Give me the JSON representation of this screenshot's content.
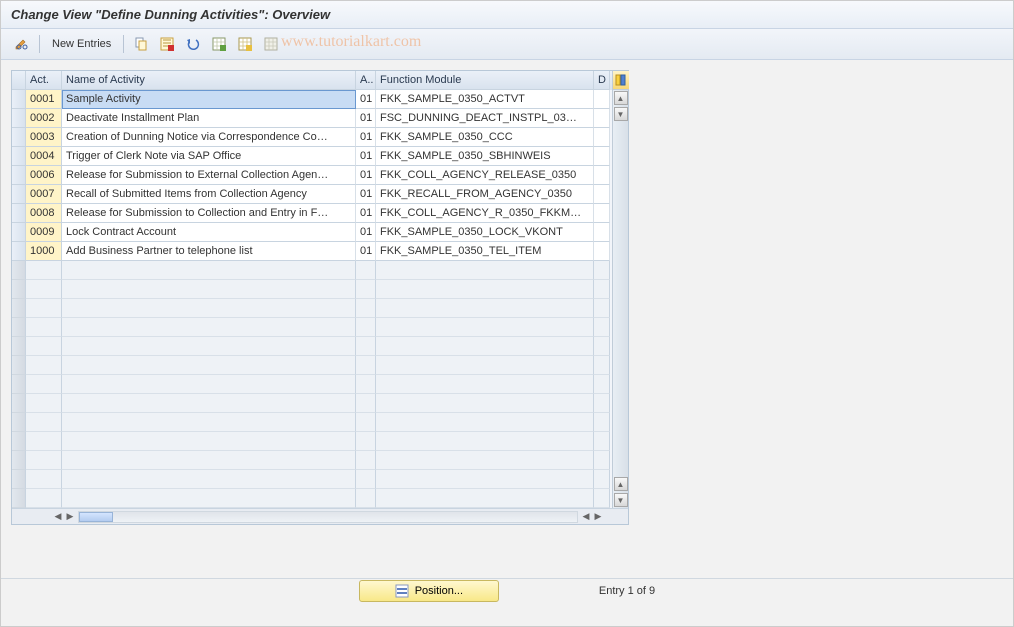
{
  "title": "Change View \"Define Dunning Activities\": Overview",
  "watermark": "www.tutorialkart.com",
  "toolbar": {
    "new_entries": "New Entries"
  },
  "table": {
    "headers": {
      "act": "Act.",
      "name": "Name of Activity",
      "a": "A..",
      "fm": "Function Module",
      "d": "D"
    },
    "rows": [
      {
        "act": "0001",
        "name": "Sample Activity",
        "a": "01",
        "fm": "FKK_SAMPLE_0350_ACTVT",
        "selected": true
      },
      {
        "act": "0002",
        "name": "Deactivate Installment Plan",
        "a": "01",
        "fm": "FSC_DUNNING_DEACT_INSTPL_03…"
      },
      {
        "act": "0003",
        "name": "Creation of Dunning Notice via Correspondence Co…",
        "a": "01",
        "fm": "FKK_SAMPLE_0350_CCC"
      },
      {
        "act": "0004",
        "name": "Trigger of Clerk Note via SAP Office",
        "a": "01",
        "fm": "FKK_SAMPLE_0350_SBHINWEIS"
      },
      {
        "act": "0006",
        "name": "Release for Submission to External Collection Agen…",
        "a": "01",
        "fm": "FKK_COLL_AGENCY_RELEASE_0350"
      },
      {
        "act": "0007",
        "name": "Recall of Submitted Items from Collection Agency",
        "a": "01",
        "fm": "FKK_RECALL_FROM_AGENCY_0350"
      },
      {
        "act": "0008",
        "name": "Release for Submission to Collection and Entry in F…",
        "a": "01",
        "fm": "FKK_COLL_AGENCY_R_0350_FKKM…"
      },
      {
        "act": "0009",
        "name": "Lock Contract Account",
        "a": "01",
        "fm": "FKK_SAMPLE_0350_LOCK_VKONT"
      },
      {
        "act": "1000",
        "name": "Add Business Partner to telephone list",
        "a": "01",
        "fm": "FKK_SAMPLE_0350_TEL_ITEM"
      }
    ],
    "empty_rows": 13
  },
  "footer": {
    "position_label": "Position...",
    "entry_text": "Entry 1 of 9"
  }
}
